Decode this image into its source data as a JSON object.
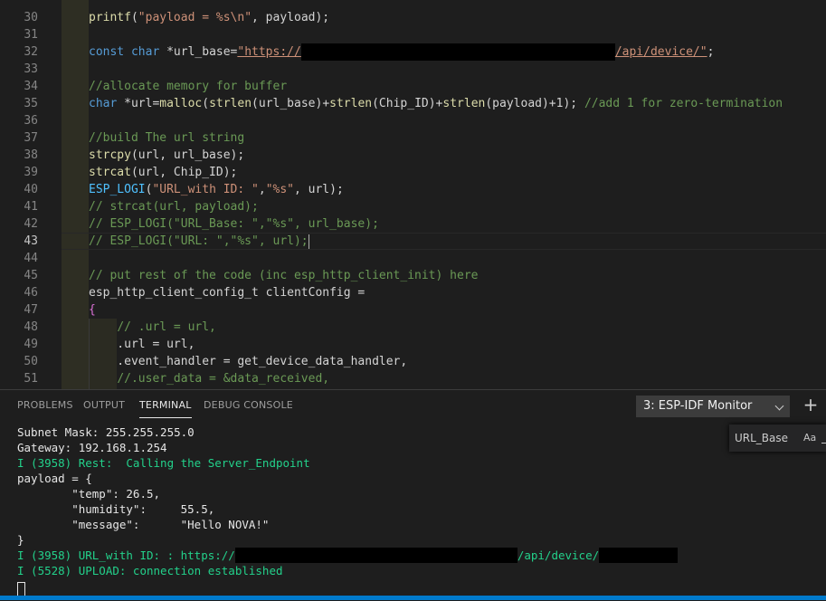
{
  "editor": {
    "lines": [
      {
        "n": "30",
        "tokens": [
          [
            "fn",
            "printf"
          ],
          [
            "d",
            "("
          ],
          [
            "str",
            "\"payload = %s\\n\""
          ],
          [
            "d",
            ", payload);"
          ]
        ]
      },
      {
        "n": "31",
        "tokens": []
      },
      {
        "n": "32",
        "tokens": [
          [
            "kw",
            "const"
          ],
          [
            "d",
            " "
          ],
          [
            "kw",
            "char"
          ],
          [
            "d",
            " *url_base="
          ],
          [
            "url",
            "\"https://"
          ],
          [
            "redact",
            ""
          ],
          [
            "url",
            "/api/device/\""
          ],
          [
            "d",
            ";"
          ]
        ]
      },
      {
        "n": "33",
        "tokens": []
      },
      {
        "n": "34",
        "tokens": [
          [
            "cm",
            "//allocate memory for buffer"
          ]
        ]
      },
      {
        "n": "35",
        "tokens": [
          [
            "kw",
            "char"
          ],
          [
            "d",
            " *url="
          ],
          [
            "fn",
            "malloc"
          ],
          [
            "d",
            "("
          ],
          [
            "fn",
            "strlen"
          ],
          [
            "d",
            "(url_base)+"
          ],
          [
            "fn",
            "strlen"
          ],
          [
            "d",
            "(Chip_ID)+"
          ],
          [
            "fn",
            "strlen"
          ],
          [
            "d",
            "(payload)+1); "
          ],
          [
            "cm",
            "//add 1 for zero-termination"
          ]
        ]
      },
      {
        "n": "36",
        "tokens": []
      },
      {
        "n": "37",
        "tokens": [
          [
            "cm",
            "//build The url string"
          ]
        ]
      },
      {
        "n": "38",
        "tokens": [
          [
            "fn",
            "strcpy"
          ],
          [
            "d",
            "(url, url_base);"
          ]
        ]
      },
      {
        "n": "39",
        "tokens": [
          [
            "fn",
            "strcat"
          ],
          [
            "d",
            "(url, Chip_ID);"
          ]
        ]
      },
      {
        "n": "40",
        "tokens": [
          [
            "mac",
            "ESP_LOGI"
          ],
          [
            "d",
            "("
          ],
          [
            "str",
            "\"URL_with ID: \""
          ],
          [
            "d",
            ","
          ],
          [
            "str",
            "\"%s\""
          ],
          [
            "d",
            ", url);"
          ]
        ]
      },
      {
        "n": "41",
        "tokens": [
          [
            "cm",
            "// strcat(url, payload);"
          ]
        ]
      },
      {
        "n": "42",
        "tokens": [
          [
            "cm",
            "// ESP_LOGI(\"URL_Base: \",\"%s\", url_base);"
          ]
        ]
      },
      {
        "n": "43",
        "tokens": [
          [
            "cm",
            "// ESP_LOGI(\"URL: \",\"%s\", url);"
          ]
        ],
        "current": true
      },
      {
        "n": "44",
        "tokens": []
      },
      {
        "n": "45",
        "tokens": [
          [
            "cm",
            "// put rest of the code (inc esp_http_client_init) here"
          ]
        ]
      },
      {
        "n": "46",
        "tokens": [
          [
            "d",
            "esp_http_client_config_t clientConfig ="
          ]
        ]
      },
      {
        "n": "47",
        "tokens": [
          [
            "br",
            "{"
          ]
        ]
      },
      {
        "n": "48",
        "tokens": [
          [
            "d",
            "    "
          ],
          [
            "cm",
            "// .url = url,"
          ]
        ]
      },
      {
        "n": "49",
        "tokens": [
          [
            "d",
            "    .url = url,"
          ]
        ]
      },
      {
        "n": "50",
        "tokens": [
          [
            "d",
            "    .event_handler = get_device_data_handler,"
          ]
        ]
      },
      {
        "n": "51",
        "tokens": [
          [
            "d",
            "    "
          ],
          [
            "cm",
            "//.user_data = &data_received,"
          ]
        ]
      }
    ]
  },
  "panel": {
    "tabs": [
      {
        "label": "PROBLEMS",
        "active": false
      },
      {
        "label": "OUTPUT",
        "active": false
      },
      {
        "label": "TERMINAL",
        "active": true
      },
      {
        "label": "DEBUG CONSOLE",
        "active": false
      }
    ],
    "terminal_select": "3: ESP-IDF Monitor",
    "new_terminal": "+",
    "find": {
      "value": "URL_Base",
      "match_case": "Aa"
    },
    "terminal_lines": [
      {
        "text": "Subnet Mask: 255.255.255.0",
        "color": "white"
      },
      {
        "text": "Gateway: 192.168.1.254",
        "color": "white"
      },
      {
        "text": "I (3958) Rest:  Calling the Server_Endpoint",
        "color": "green"
      },
      {
        "text": "payload = {",
        "color": "white"
      },
      {
        "text": "        \"temp\": 26.5,",
        "color": "white"
      },
      {
        "text": "        \"humidity\":     55.5,",
        "color": "white"
      },
      {
        "text": "        \"message\":      \"Hello NOVA!\"",
        "color": "white"
      },
      {
        "text": "}",
        "color": "white"
      },
      {
        "text": "I (3958) URL_with ID: : https://",
        "color": "green",
        "redact_after": true,
        "suffix": "/api/device/",
        "redact_end": true
      },
      {
        "text": "I (5528) UPLOAD: connection established",
        "color": "green"
      }
    ]
  },
  "colors": {
    "accent": "#007acc",
    "green": "#23d18b"
  }
}
